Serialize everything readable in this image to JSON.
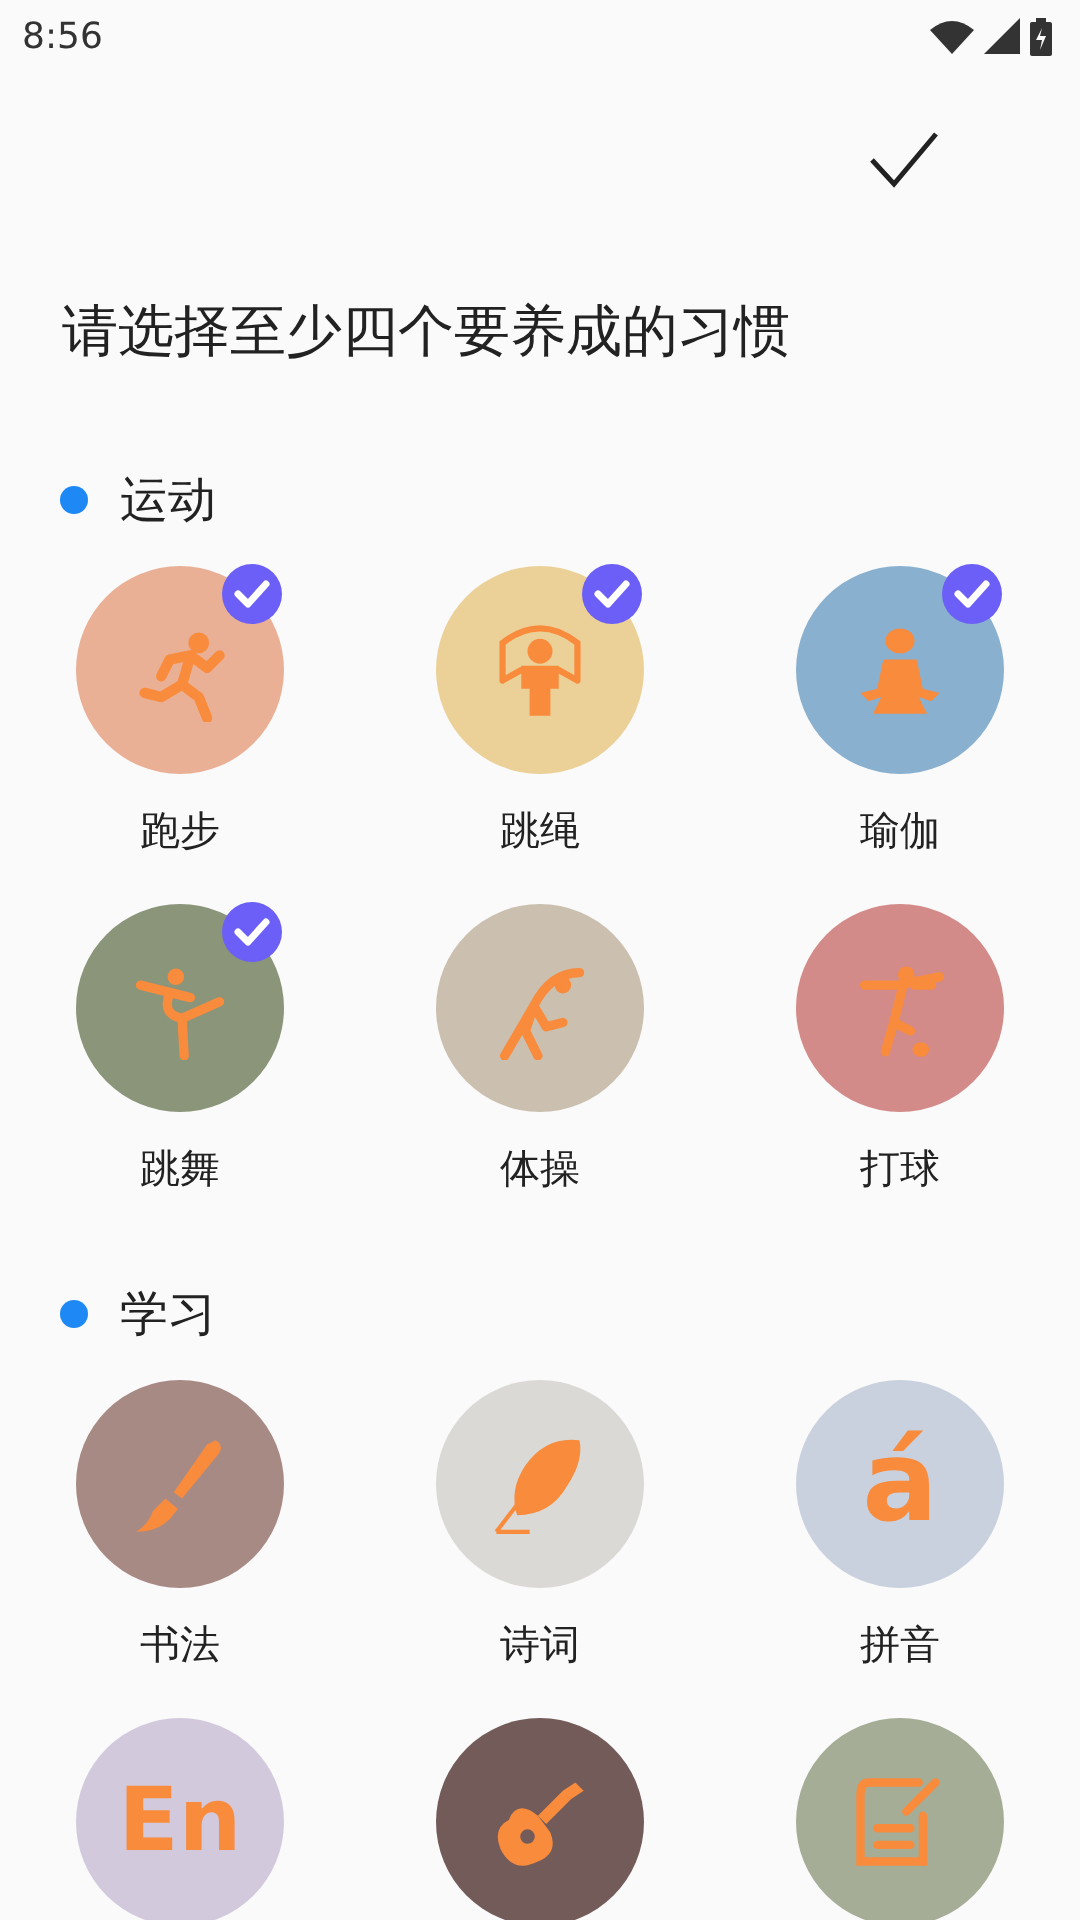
{
  "status_bar": {
    "time": "8:56"
  },
  "title": "请选择至少四个要养成的习惯",
  "sections": [
    {
      "title": "运动",
      "items": [
        {
          "label": "跑步",
          "color": "#eab096",
          "selected": true,
          "kind": "icon"
        },
        {
          "label": "跳绳",
          "color": "#ebd098",
          "selected": true,
          "kind": "icon"
        },
        {
          "label": "瑜伽",
          "color": "#8ab0d0",
          "selected": true,
          "kind": "icon"
        },
        {
          "label": "跳舞",
          "color": "#8a957a",
          "selected": true,
          "kind": "icon"
        },
        {
          "label": "体操",
          "color": "#cbc0af",
          "selected": false,
          "kind": "icon"
        },
        {
          "label": "打球",
          "color": "#d28b89",
          "selected": false,
          "kind": "icon"
        }
      ]
    },
    {
      "title": "学习",
      "items": [
        {
          "label": "书法",
          "color": "#a88a85",
          "selected": false,
          "kind": "icon"
        },
        {
          "label": "诗词",
          "color": "#dad9d5",
          "selected": false,
          "kind": "icon"
        },
        {
          "label": "拼音",
          "color": "#cad1de",
          "selected": false,
          "kind": "glyph",
          "glyph": "á"
        },
        {
          "color": "#d2c9dc",
          "selected": false,
          "kind": "glyph",
          "glyph": "En"
        },
        {
          "color": "#735b5a",
          "selected": false,
          "kind": "icon"
        },
        {
          "color": "#a5ad96",
          "selected": false,
          "kind": "icon"
        }
      ]
    }
  ]
}
